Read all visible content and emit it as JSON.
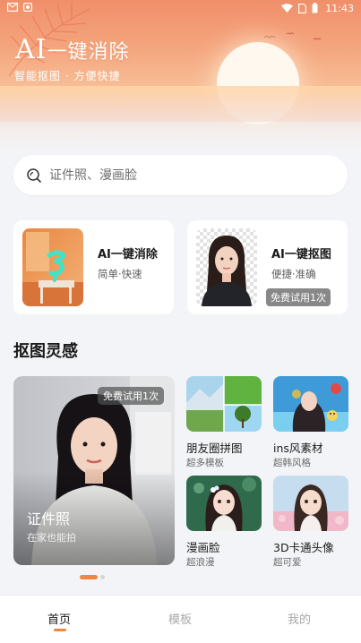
{
  "status_bar": {
    "time": "11:43",
    "icons": [
      "mail-icon",
      "app-notification-icon",
      "wifi-icon",
      "sim-icon",
      "battery-icon"
    ]
  },
  "hero": {
    "title_latin": "AI",
    "title_cn": "一键消除",
    "subtitle": "智能抠图 · 方便快捷"
  },
  "search": {
    "placeholder": "证件照、漫画脸",
    "icon": "search-icon"
  },
  "feature_cards": [
    {
      "title": "AI一键消除",
      "subtitle": "简单·快速"
    },
    {
      "title": "AI一键抠图",
      "subtitle": "便捷·准确",
      "badge": "免费试用1次"
    }
  ],
  "section": {
    "title": "抠图灵感"
  },
  "inspiration": {
    "featured": {
      "title": "证件照",
      "subtitle": "在家也能拍",
      "badge": "免费试用1次"
    },
    "tiles": [
      {
        "title": "朋友圈拼图",
        "subtitle": "超多模板"
      },
      {
        "title": "ins风素材",
        "subtitle": "超韩风格"
      },
      {
        "title": "漫画脸",
        "subtitle": "超浪漫"
      },
      {
        "title": "3D卡通头像",
        "subtitle": "超可爱"
      }
    ]
  },
  "tabbar": {
    "tabs": [
      "首页",
      "模板",
      "我的"
    ],
    "active": "首页"
  },
  "colors": {
    "accent": "#f2853f",
    "hero_top": "#f08f6a",
    "background": "#f3f4f7"
  }
}
